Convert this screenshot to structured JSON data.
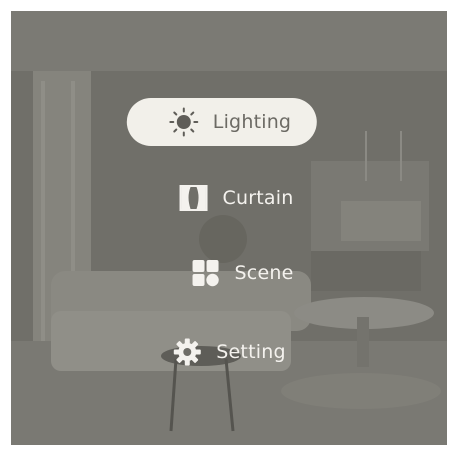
{
  "menu": {
    "items": [
      {
        "label": "Lighting",
        "icon": "sun-icon",
        "active": true
      },
      {
        "label": "Curtain",
        "icon": "curtain-icon",
        "active": false
      },
      {
        "label": "Scene",
        "icon": "scene-grid-icon",
        "active": false
      },
      {
        "label": "Setting",
        "icon": "gear-icon",
        "active": false
      }
    ]
  },
  "colors": {
    "overlay": "#6e6d67",
    "active_pill": "#f2f0ea",
    "active_text": "#6c6a64",
    "text": "#f4f2ee"
  }
}
